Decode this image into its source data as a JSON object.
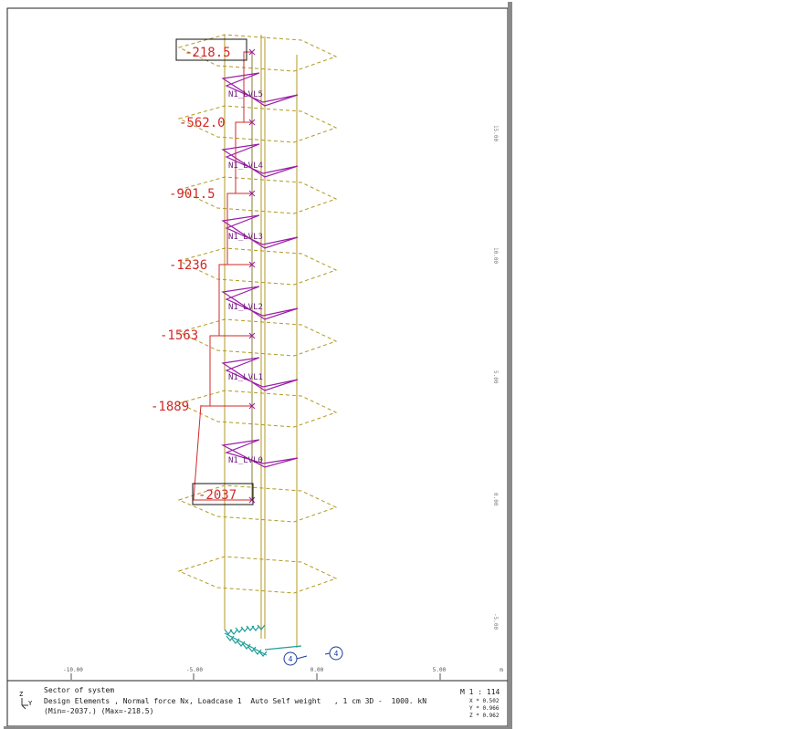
{
  "view": {
    "force_labels": [
      "-218.5",
      "-562.0",
      "-901.5",
      "-1236",
      "-1563",
      "-1889",
      "-2037"
    ],
    "level_labels": [
      "N1_LVL5",
      "N1_LVL4",
      "N1_LVL3",
      "N1_LVL2",
      "N1_LVL1",
      "N1_LVL0"
    ],
    "x_ticks": [
      "-10.00",
      "-5.00",
      "0.00",
      "5.00"
    ],
    "x_unit": "m",
    "z_ticks": [
      "15.00",
      "10.00",
      "5.00",
      "0.00",
      "-5.00"
    ],
    "axis_markers": [
      "4",
      "4"
    ],
    "colors": {
      "force": "#d22a2a",
      "structure": "#b09a20",
      "elements": "#9a1ea8",
      "supports": "#1f9e9a",
      "marker": "#1b3a9a"
    }
  },
  "footer": {
    "line1": "Sector of system",
    "line2": "Design Elements , Normal force Nx, Loadcase 1  Auto Self weight   , 1 cm 3D -  1000. kN",
    "line3": "(Min=-2037.) (Max=-218.5)",
    "scale": "M 1 : 114",
    "x": "X * 0.502",
    "y": "Y * 0.966",
    "z": "Z * 0.962",
    "axis_z": "Z",
    "axis_y": "Y"
  }
}
